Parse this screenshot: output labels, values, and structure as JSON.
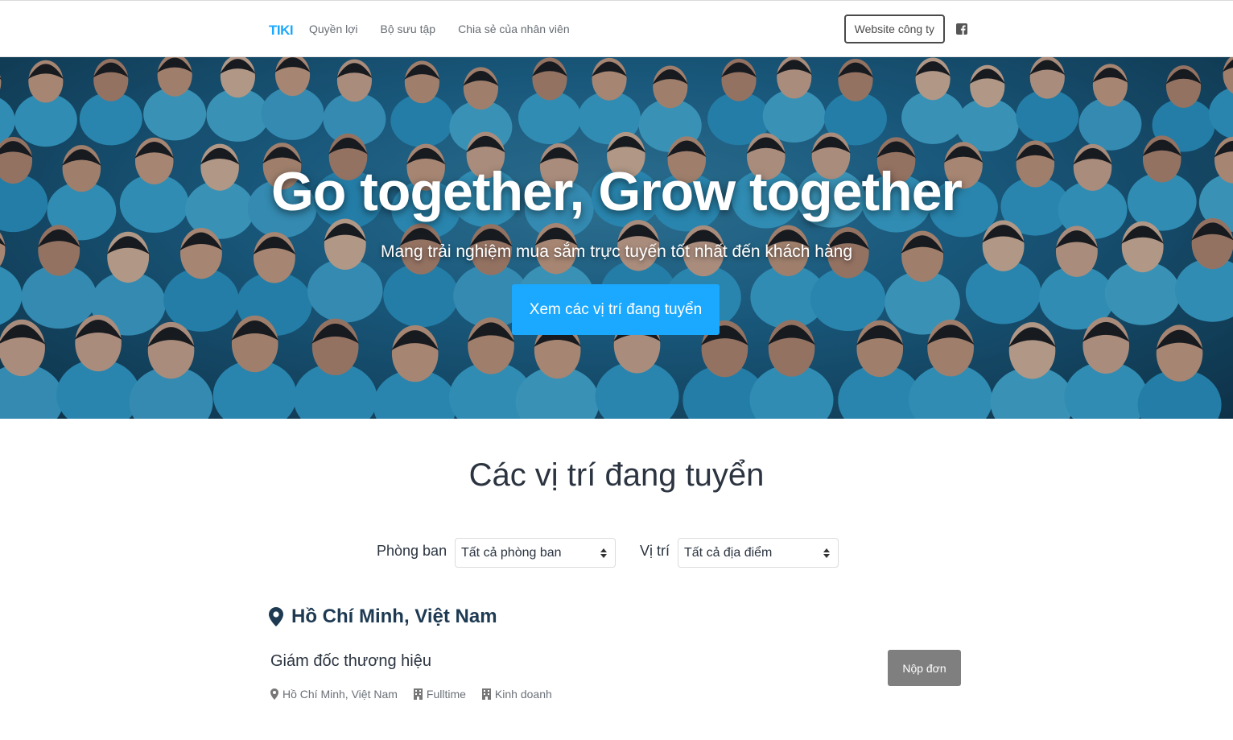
{
  "header": {
    "logo_text": "TIKI",
    "nav_links": [
      {
        "label": "Quyền lợi"
      },
      {
        "label": "Bộ sưu tập"
      },
      {
        "label": "Chia sẻ của nhân viên"
      }
    ],
    "company_website_label": "Website công ty",
    "social_icon": "facebook-icon"
  },
  "hero": {
    "title": "Go together, Grow together",
    "subtitle": "Mang trải nghiệm mua sắm trực tuyến tốt nhất đến khách hàng",
    "cta_label": "Xem các vị trí đang tuyển"
  },
  "jobs": {
    "section_title": "Các vị trí đang tuyển",
    "filters": {
      "department_label": "Phòng ban",
      "department_selected": "Tất cả phòng ban",
      "location_label": "Vị trí",
      "location_selected": "Tất cả địa điểm"
    },
    "groups": [
      {
        "location": "Hồ Chí Minh, Việt Nam",
        "positions": [
          {
            "title": "Giám đốc thương hiệu",
            "location": "Hồ Chí Minh, Việt Nam",
            "type": "Fulltime",
            "department": "Kinh doanh",
            "apply_label": "Nộp đơn"
          }
        ]
      }
    ]
  },
  "colors": {
    "brand_blue": "#1ba8ff",
    "apply_gray": "#7f7f7f",
    "heading_navy": "#1e3a52"
  }
}
